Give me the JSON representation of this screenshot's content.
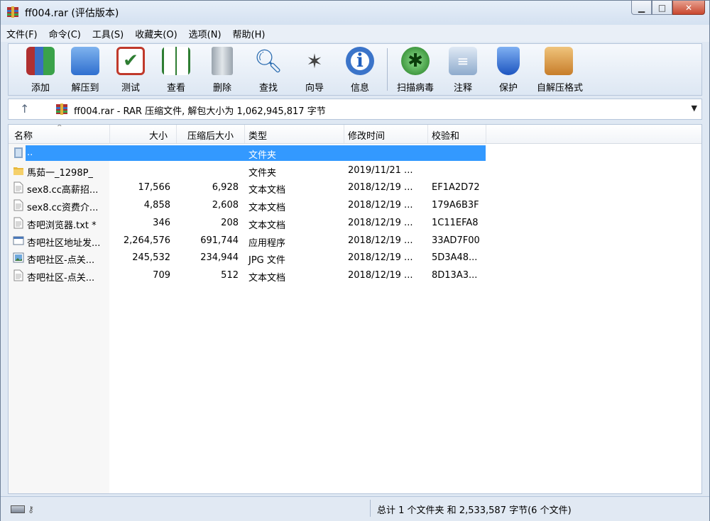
{
  "window": {
    "title": "ff004.rar (评估版本)"
  },
  "menu": [
    "文件(F)",
    "命令(C)",
    "工具(S)",
    "收藏夹(O)",
    "选项(N)",
    "帮助(H)"
  ],
  "toolbar": [
    {
      "label": "添加",
      "icon": "add-archive-icon",
      "color": "#c0392b"
    },
    {
      "label": "解压到",
      "icon": "extract-folder-icon",
      "color": "#3b7dd8"
    },
    {
      "label": "测试",
      "icon": "test-checklist-icon",
      "color": "#c0392b"
    },
    {
      "label": "查看",
      "icon": "view-book-icon",
      "color": "#2e7d32"
    },
    {
      "label": "删除",
      "icon": "trash-icon",
      "color": "#7f8c8d"
    },
    {
      "label": "查找",
      "icon": "magnifier-icon",
      "color": "#2b6cb0"
    },
    {
      "label": "向导",
      "icon": "magic-wand-icon",
      "color": "#555"
    },
    {
      "label": "信息",
      "icon": "info-icon",
      "color": "#1f5fbf"
    },
    {
      "label": "扫描病毒",
      "icon": "virus-scan-icon",
      "color": "#2e8b2e"
    },
    {
      "label": "注释",
      "icon": "comment-icon",
      "color": "#6c8fb6"
    },
    {
      "label": "保护",
      "icon": "shield-icon",
      "color": "#2f6fd6"
    },
    {
      "label": "自解压格式",
      "icon": "sfx-box-icon",
      "color": "#c77d2a"
    }
  ],
  "address": {
    "text": "ff004.rar - RAR 压缩文件, 解包大小为 1,062,945,817 字节"
  },
  "columns": [
    "名称",
    "大小",
    "压缩后大小",
    "类型",
    "修改时间",
    "校验和"
  ],
  "files": [
    {
      "name": "..",
      "size": "",
      "packed": "",
      "type": "文件夹",
      "modified": "",
      "crc": "",
      "icon": "parent-folder-icon",
      "selected": true
    },
    {
      "name": "馬茹一_1298P_",
      "size": "",
      "packed": "",
      "type": "文件夹",
      "modified": "2019/11/21 ...",
      "crc": "",
      "icon": "folder-icon",
      "selected": false
    },
    {
      "name": "sex8.cc高薪招...",
      "size": "17,566",
      "packed": "6,928",
      "type": "文本文档",
      "modified": "2018/12/19 ...",
      "crc": "EF1A2D72",
      "icon": "text-file-icon",
      "selected": false
    },
    {
      "name": "sex8.cc资费介...",
      "size": "4,858",
      "packed": "2,608",
      "type": "文本文档",
      "modified": "2018/12/19 ...",
      "crc": "179A6B3F",
      "icon": "text-file-icon",
      "selected": false
    },
    {
      "name": "杏吧浏览器.txt *",
      "size": "346",
      "packed": "208",
      "type": "文本文档",
      "modified": "2018/12/19 ...",
      "crc": "1C11EFA8",
      "icon": "text-file-icon",
      "selected": false
    },
    {
      "name": "杏吧社区地址发...",
      "size": "2,264,576",
      "packed": "691,744",
      "type": "应用程序",
      "modified": "2018/12/19 ...",
      "crc": "33AD7F00",
      "icon": "application-icon",
      "selected": false
    },
    {
      "name": "杏吧社区-点关...",
      "size": "245,532",
      "packed": "234,944",
      "type": "JPG 文件",
      "modified": "2018/12/19 ...",
      "crc": "5D3A48...",
      "icon": "image-file-icon",
      "selected": false
    },
    {
      "name": "杏吧社区-点关...",
      "size": "709",
      "packed": "512",
      "type": "文本文档",
      "modified": "2018/12/19 ...",
      "crc": "8D13A3...",
      "icon": "text-file-icon",
      "selected": false
    }
  ],
  "status": {
    "text": "总计 1 个文件夹 和 2,533,587 字节(6 个文件)"
  }
}
